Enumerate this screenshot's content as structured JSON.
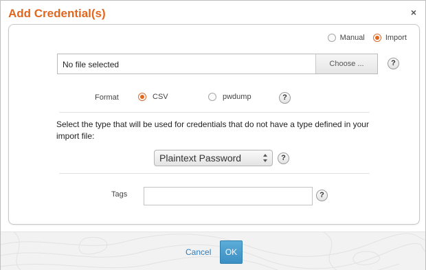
{
  "dialog": {
    "title": "Add Credential(s)",
    "close_glyph": "×",
    "accent_color": "#e2661c"
  },
  "mode": {
    "options": [
      {
        "label": "Manual",
        "selected": false
      },
      {
        "label": "Import",
        "selected": true
      }
    ]
  },
  "file": {
    "value": "No file selected",
    "choose_label": "Choose ..."
  },
  "format": {
    "label": "Format",
    "options": [
      {
        "label": "CSV",
        "selected": true
      },
      {
        "label": "pwdump",
        "selected": false
      }
    ]
  },
  "type_select": {
    "description": "Select the type that will be used for credentials that do not have a type defined in your import file:",
    "selected": "Plaintext Password"
  },
  "tags": {
    "label": "Tags",
    "value": ""
  },
  "help_glyph": "?",
  "footer": {
    "cancel_label": "Cancel",
    "ok_label": "OK"
  }
}
